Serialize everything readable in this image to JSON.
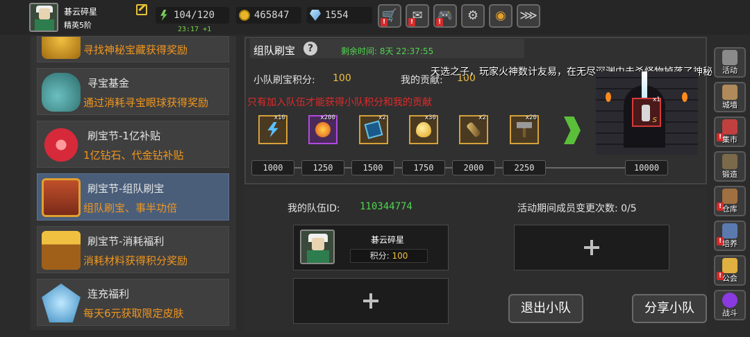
{
  "player": {
    "name": "碁云碎星",
    "rank": "精英5阶"
  },
  "stats": {
    "energy": "104/120",
    "energy_timer": "23:17 +1",
    "coins": "465847",
    "gems": "1554"
  },
  "top_buttons": [
    "shop-cart-icon",
    "mail-icon",
    "gamepad-icon",
    "gear-icon",
    "color-wheel-icon",
    "wings-icon"
  ],
  "menu": [
    {
      "title": "",
      "desc": "寻找神秘宝藏获得奖励"
    },
    {
      "title": "寻宝基金",
      "desc": "通过消耗寻宝眼球获得奖励"
    },
    {
      "title": "刷宝节-1亿补贴",
      "desc": "1亿钻石、代金钻补贴"
    },
    {
      "title": "刷宝节-组队刷宝",
      "desc": "组队刷宝、事半功倍"
    },
    {
      "title": "刷宝节-消耗福利",
      "desc": "消耗材料获得积分奖励"
    },
    {
      "title": "连充福利",
      "desc": "每天6元获取限定皮肤"
    }
  ],
  "event": {
    "title": "组队刷宝",
    "remaining": "剩余时间: 8天 22:37:55",
    "team_points_label": "小队刷宝积分:",
    "team_points": "100",
    "my_contrib_label": "我的贡献:",
    "my_contrib": "100",
    "warning": "只有加入队伍才能获得小队积分和我的贡献",
    "banner": "天选之子，玩家火神数计友易，在无尽深渊中击杀怪物掉落了神秘"
  },
  "rewards": [
    {
      "count": "x10",
      "icon": "lightning-scroll-icon"
    },
    {
      "count": "x200",
      "icon": "fire-orb-icon"
    },
    {
      "count": "x2",
      "icon": "spellbook-icon"
    },
    {
      "count": "x30",
      "icon": "golden-egg-icon"
    },
    {
      "count": "x2",
      "icon": "telescope-icon"
    },
    {
      "count": "x20",
      "icon": "hammer-icon"
    }
  ],
  "milestones": [
    "1000",
    "1250",
    "1500",
    "1750",
    "2000",
    "2250",
    "10000"
  ],
  "preview_item": {
    "count": "x1",
    "tier": "S"
  },
  "team": {
    "id_label": "我的队伍ID:",
    "id": "110344774",
    "change_label": "活动期间成员变更次数: 0/5",
    "member_name": "碁云碎星",
    "member_pts_label": "积分:",
    "member_pts": "100",
    "leave_label": "退出小队",
    "share_label": "分享小队"
  },
  "sidebar": [
    {
      "label": "活动",
      "icon": "helmet-icon"
    },
    {
      "label": "城墙",
      "icon": "castle-wall-icon"
    },
    {
      "label": "集市",
      "icon": "market-icon"
    },
    {
      "label": "锻造",
      "icon": "anvil-icon"
    },
    {
      "label": "仓库",
      "icon": "warehouse-icon"
    },
    {
      "label": "培养",
      "icon": "training-icon"
    },
    {
      "label": "公会",
      "icon": "guild-icon"
    },
    {
      "label": "战斗",
      "icon": "battle-icon"
    }
  ],
  "colors": {
    "accent_orange": "#f0961e",
    "accent_green": "#4fd64f",
    "warning_red": "#e02a2a",
    "active_blue": "#4a5e7a"
  }
}
